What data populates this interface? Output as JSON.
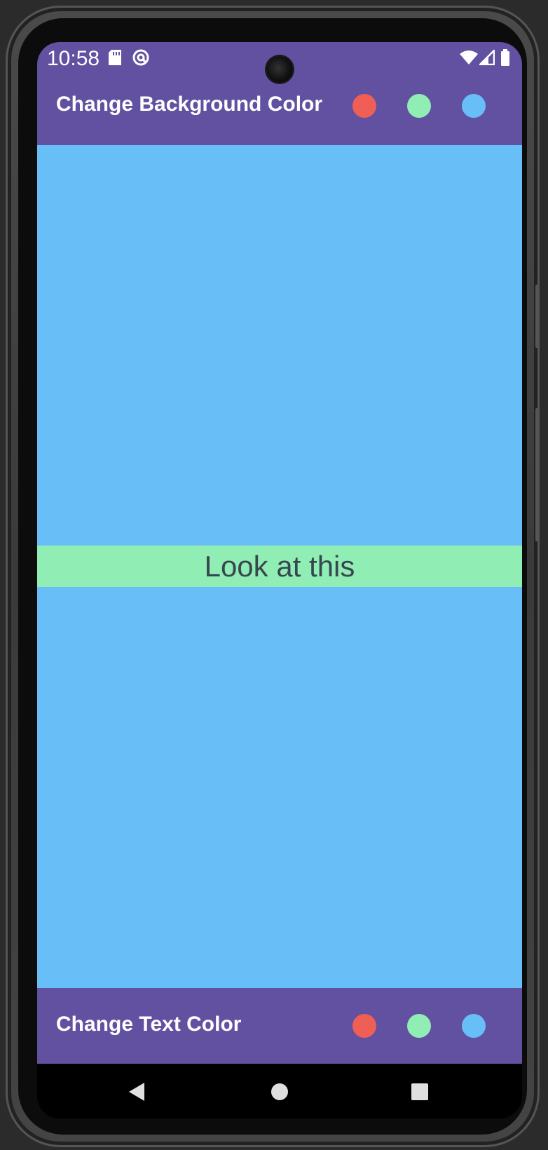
{
  "status_bar": {
    "time": "10:58",
    "left_icons": [
      "sd-card-icon",
      "at-sign-icon"
    ],
    "right_icons": [
      "wifi-icon",
      "signal-icon",
      "battery-icon"
    ]
  },
  "top_bar": {
    "title": "Change Background Color",
    "color_options": [
      {
        "name": "red",
        "color": "#ef5f56"
      },
      {
        "name": "green",
        "color": "#90eeb4"
      },
      {
        "name": "blue",
        "color": "#68bff7"
      }
    ]
  },
  "main": {
    "background_color": "#68bff7",
    "text": "Look at this",
    "text_background_color": "#90eeb4",
    "text_color": "#37474f"
  },
  "bottom_bar": {
    "title": "Change Text Color",
    "color_options": [
      {
        "name": "red",
        "color": "#ef5f56"
      },
      {
        "name": "green",
        "color": "#90eeb4"
      },
      {
        "name": "blue",
        "color": "#68bff7"
      }
    ]
  },
  "nav_bar": {
    "buttons": [
      "back-icon",
      "home-icon",
      "recents-icon"
    ]
  },
  "colors": {
    "bar": "#6251a0"
  }
}
